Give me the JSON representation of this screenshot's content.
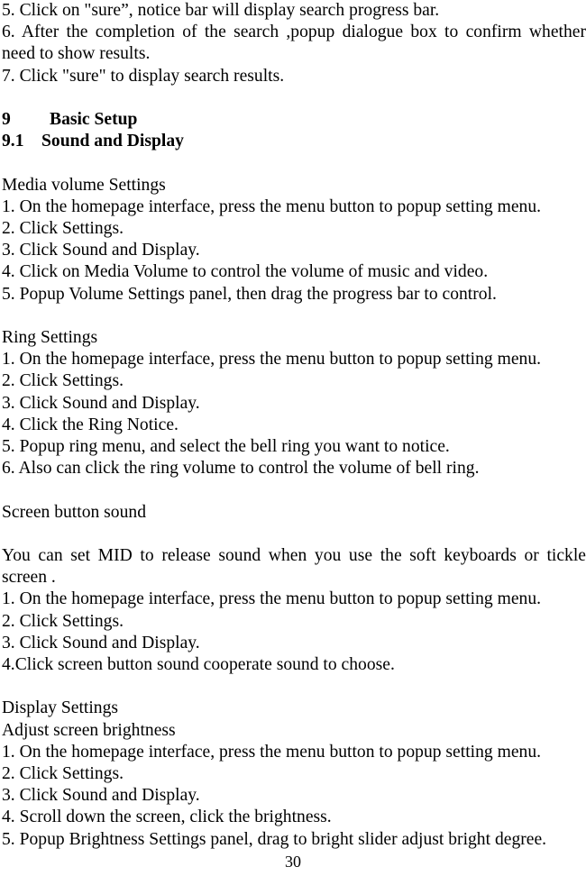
{
  "document": {
    "page_number": "30",
    "blocks": [
      {
        "type": "line",
        "text": "5. Click on \"sure”, notice bar will display search progress bar."
      },
      {
        "type": "paragraph-justified",
        "lines": [
          "6. After the completion of the search ,popup dialogue box to confirm whether",
          "need to show results."
        ]
      },
      {
        "type": "line",
        "text": "7. Click \"sure\" to display search results."
      },
      {
        "type": "blank"
      },
      {
        "type": "heading",
        "number": "9",
        "text": "Basic Setup",
        "level": 1
      },
      {
        "type": "heading",
        "number": "9.1",
        "text": "Sound and Display",
        "level": 2
      },
      {
        "type": "blank"
      },
      {
        "type": "line",
        "text": "Media volume Settings"
      },
      {
        "type": "line",
        "text": "1. On the homepage interface, press the menu button to popup setting menu."
      },
      {
        "type": "line",
        "text": "2. Click Settings."
      },
      {
        "type": "line",
        "text": "3. Click Sound and Display."
      },
      {
        "type": "line",
        "text": "4. Click on Media Volume to control the volume of music and video."
      },
      {
        "type": "line",
        "text": "5. Popup Volume Settings panel, then drag the progress bar to control."
      },
      {
        "type": "blank"
      },
      {
        "type": "line",
        "text": "Ring Settings"
      },
      {
        "type": "line",
        "text": "1. On the homepage interface, press the menu button to popup setting menu."
      },
      {
        "type": "line",
        "text": "2. Click Settings."
      },
      {
        "type": "line",
        "text": "3. Click Sound and Display."
      },
      {
        "type": "line",
        "text": "4. Click the Ring Notice."
      },
      {
        "type": "line",
        "text": "5. Popup ring menu, and select the bell ring you want to notice."
      },
      {
        "type": "line",
        "text": "6. Also can click the ring volume to control the volume of bell ring."
      },
      {
        "type": "blank"
      },
      {
        "type": "line",
        "text": "Screen button sound"
      },
      {
        "type": "blank"
      },
      {
        "type": "paragraph-justified",
        "lines": [
          "You can set MID to release sound when you use the soft keyboards or tickle",
          "screen ."
        ]
      },
      {
        "type": "line",
        "text": "1. On the homepage interface, press the menu button to popup setting menu."
      },
      {
        "type": "line",
        "text": "2. Click Settings."
      },
      {
        "type": "line",
        "text": "3. Click Sound and Display."
      },
      {
        "type": "line",
        "text": "4.Click screen button sound cooperate sound to choose."
      },
      {
        "type": "blank"
      },
      {
        "type": "line",
        "text": "Display Settings"
      },
      {
        "type": "line",
        "text": "Adjust screen brightness"
      },
      {
        "type": "line",
        "text": "1. On the homepage interface, press the menu button to popup setting menu."
      },
      {
        "type": "line",
        "text": "2. Click Settings."
      },
      {
        "type": "line",
        "text": "3. Click Sound and Display."
      },
      {
        "type": "line",
        "text": "4. Scroll down the screen, click the brightness."
      },
      {
        "type": "line",
        "text": "5. Popup Brightness Settings panel, drag to bright slider adjust bright degree."
      }
    ]
  }
}
